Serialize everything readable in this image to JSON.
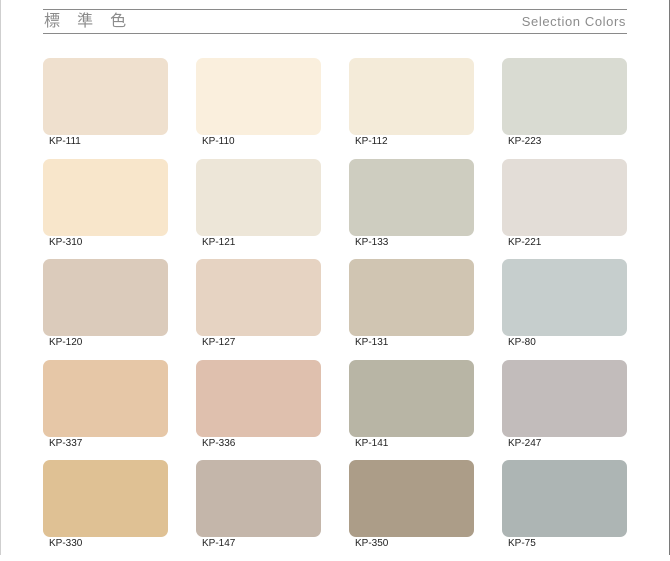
{
  "header": {
    "title_zh": "標 準 色",
    "title_en": "Selection Colors"
  },
  "swatches": [
    {
      "code": "KP-111",
      "color": "#efe0ce"
    },
    {
      "code": "KP-110",
      "color": "#faefdd"
    },
    {
      "code": "KP-112",
      "color": "#f4ebd9"
    },
    {
      "code": "KP-223",
      "color": "#d9dbd2"
    },
    {
      "code": "KP-310",
      "color": "#f8e6cb"
    },
    {
      "code": "KP-121",
      "color": "#ede6d8"
    },
    {
      "code": "KP-133",
      "color": "#cecdc0"
    },
    {
      "code": "KP-221",
      "color": "#e3ddd7"
    },
    {
      "code": "KP-120",
      "color": "#dbcbbb"
    },
    {
      "code": "KP-127",
      "color": "#e6d3c2"
    },
    {
      "code": "KP-131",
      "color": "#d0c5b2"
    },
    {
      "code": "KP-80",
      "color": "#c6cecd"
    },
    {
      "code": "KP-337",
      "color": "#e6c7a7"
    },
    {
      "code": "KP-336",
      "color": "#dfc0ae"
    },
    {
      "code": "KP-141",
      "color": "#b8b5a5"
    },
    {
      "code": "KP-247",
      "color": "#c2bcbb"
    },
    {
      "code": "KP-330",
      "color": "#dfc194"
    },
    {
      "code": "KP-147",
      "color": "#c4b6aa"
    },
    {
      "code": "KP-350",
      "color": "#ac9d88"
    },
    {
      "code": "KP-75",
      "color": "#adb5b4"
    }
  ]
}
